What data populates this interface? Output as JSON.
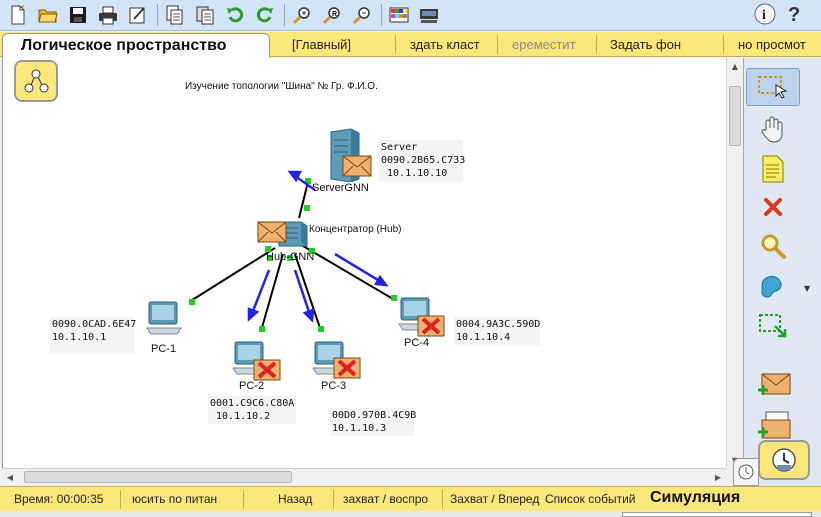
{
  "toolbar": {
    "buttons": [
      {
        "name": "new-file-icon"
      },
      {
        "name": "open-folder-icon"
      },
      {
        "name": "save-icon"
      },
      {
        "name": "print-icon"
      },
      {
        "name": "activity-wizard-icon"
      },
      {
        "name": "copy-icon"
      },
      {
        "name": "paste-icon"
      },
      {
        "name": "undo-icon"
      },
      {
        "name": "redo-icon"
      },
      {
        "name": "zoom-in-icon"
      },
      {
        "name": "zoom-reset-icon"
      },
      {
        "name": "zoom-out-icon"
      },
      {
        "name": "palette-icon"
      },
      {
        "name": "custom-device-icon"
      }
    ],
    "right": [
      {
        "name": "info-icon",
        "glyph": "i"
      },
      {
        "name": "help-icon",
        "glyph": "?"
      }
    ]
  },
  "logicbar": {
    "title": "Логическое пространство",
    "items": [
      {
        "label": "[Главный]",
        "disabled": false
      },
      {
        "label": "здать класт",
        "disabled": false
      },
      {
        "label": "ереместит",
        "disabled": true
      },
      {
        "label": "Задать фон",
        "disabled": false
      },
      {
        "label": "но просмот",
        "disabled": false
      }
    ]
  },
  "canvas": {
    "topology_title": "Изучение топологии \"Шина\" № Гр. Ф.И.О.",
    "devices": {
      "server": {
        "name": "ServerGNN",
        "info": "Server\n0090.2B65.C733\n 10.1.10.10"
      },
      "hub": {
        "name": "Hub-GNN",
        "label": "Концентратор (Hub)"
      },
      "pc1": {
        "name": "PC-1",
        "info": "0090.0CAD.6E47\n10.1.10.1"
      },
      "pc2": {
        "name": "PC-2",
        "info": "0001.C9C6.C80A\n 10.1.10.2"
      },
      "pc3": {
        "name": "PC-3",
        "info": "00D0.970B.4C9B\n10.1.10.3"
      },
      "pc4": {
        "name": "PC-4",
        "info": "0004.9A3C.590D\n10.1.10.4"
      }
    },
    "colors": {
      "link": "#000000",
      "port": "#22cc22",
      "arrow": "#2424e0",
      "envelope": "#f0b070",
      "fail_x": "#dd2222"
    }
  },
  "palette": {
    "tools": [
      {
        "name": "select-tool-icon",
        "active": true
      },
      {
        "name": "move-hand-icon",
        "active": false
      },
      {
        "name": "place-note-icon",
        "active": false
      },
      {
        "name": "delete-icon",
        "active": false
      },
      {
        "name": "inspect-icon",
        "active": false
      },
      {
        "name": "draw-shape-icon",
        "active": false
      },
      {
        "name": "resize-shape-icon",
        "active": false
      },
      {
        "name": "add-simple-pdu-icon",
        "active": false
      },
      {
        "name": "add-complex-pdu-icon",
        "active": false
      }
    ]
  },
  "statusbar": {
    "items": [
      {
        "label": "Время: 00:00:35"
      },
      {
        "label": "юсить по питан"
      },
      {
        "label": "Назад"
      },
      {
        "label": "захват / воспро"
      },
      {
        "label": "Захват / Вперед"
      },
      {
        "label": "Список событий"
      }
    ],
    "mode": "Симуляция"
  }
}
